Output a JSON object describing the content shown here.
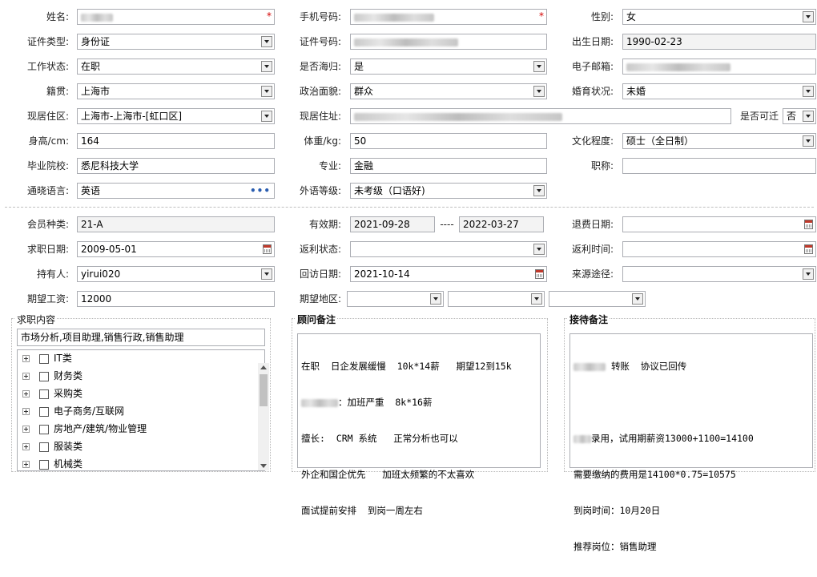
{
  "labels": {
    "name": "姓名:",
    "phone": "手机号码:",
    "gender": "性别:",
    "id_type": "证件类型:",
    "id_no": "证件号码:",
    "birth": "出生日期:",
    "work_status": "工作状态:",
    "returnee": "是否海归:",
    "email": "电子邮箱:",
    "native": "籍贯:",
    "political": "政治面貌:",
    "marital": "婚育状况:",
    "residence": "现居住区:",
    "address": "现居住址:",
    "relocate": "是否可迁",
    "height": "身高/cm:",
    "weight": "体重/kg:",
    "education": "文化程度:",
    "school": "毕业院校:",
    "major": "专业:",
    "title": "职称:",
    "language": "通晓语言:",
    "lang_level": "外语等级:",
    "member_type": "会员种类:",
    "valid": "有效期:",
    "valid_sep": "----",
    "refund_date": "退费日期:",
    "job_date": "求职日期:",
    "rebate_status": "返利状态:",
    "rebate_time": "返利时间:",
    "holder": "持有人:",
    "visit_date": "回访日期:",
    "source": "来源途径:",
    "salary": "期望工资:",
    "region": "期望地区:"
  },
  "values": {
    "gender": "女",
    "id_type": "身份证",
    "birth": "1990-02-23",
    "work_status": "在职",
    "returnee": "是",
    "native": "上海市",
    "political": "群众",
    "marital": "未婚",
    "residence": "上海市-上海市-[虹口区]",
    "relocate": "否",
    "height": "164",
    "weight": "50",
    "education": "硕士（全日制）",
    "school": "悉尼科技大学",
    "major": "金融",
    "title": "",
    "language": "英语",
    "lang_level": "未考级（口语好)",
    "member_type": "21-A",
    "valid_from": "2021-09-28",
    "valid_to": "2022-03-27",
    "job_date": "2009-05-01",
    "holder": "yirui020",
    "visit_date": "2021-10-14",
    "salary": "12000"
  },
  "job_panel": {
    "title": "求职内容",
    "selected": "市场分析,项目助理,销售行政,销售助理",
    "categories": [
      "IT类",
      "财务类",
      "采购类",
      "电子商务/互联网",
      "房地产/建筑/物业管理",
      "服装类",
      "机械类"
    ]
  },
  "advisor_panel": {
    "title": "顾问备注",
    "lines": [
      "在职  日企发展缓慢  10k*14薪   期望12到15k",
      "：加班严重  8k*16薪",
      "擅长:  CRM 系统   正常分析也可以",
      "外企和国企优先   加班太频繁的不太喜欢",
      "面试提前安排  到岗一周左右"
    ]
  },
  "reception_panel": {
    "title": "接待备注",
    "lines": [
      "转账  协议已回传",
      "",
      "录用，试用期薪资13000+1100=14100",
      "需要缴纳的费用是14100*0.75=10575",
      "到岗时间：10月20日",
      "推荐岗位：销售助理"
    ]
  },
  "required_mark": "*",
  "colors": {
    "required": "#d40000",
    "border": "#abadb3",
    "readonly_bg": "#f3f3f3"
  }
}
